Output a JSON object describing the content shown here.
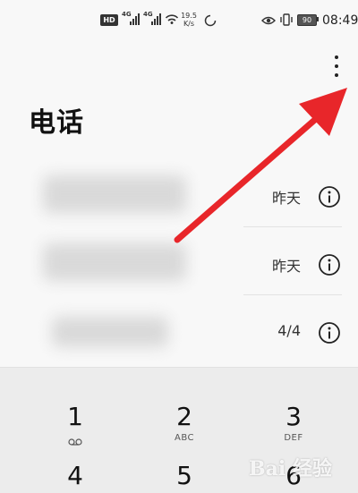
{
  "status_bar": {
    "hd_label": "HD",
    "signal_1_label": "4G",
    "signal_2_label": "4G",
    "network_speed_value": "19.5",
    "network_speed_unit": "K/s",
    "battery_level": "90",
    "time": "08:49"
  },
  "header": {
    "title": "电话"
  },
  "call_log": [
    {
      "name": "",
      "date": "昨天"
    },
    {
      "name": "",
      "date": "昨天"
    },
    {
      "name": "",
      "date": "4/4"
    }
  ],
  "dialpad": {
    "keys": [
      {
        "digit": "1",
        "letters": ""
      },
      {
        "digit": "2",
        "letters": "ABC"
      },
      {
        "digit": "3",
        "letters": "DEF"
      },
      {
        "digit": "4",
        "letters": ""
      },
      {
        "digit": "5",
        "letters": ""
      },
      {
        "digit": "6",
        "letters": ""
      }
    ]
  },
  "annotation": {
    "arrow_color": "#e8262a"
  },
  "watermark": {
    "text": "Bai 经验"
  },
  "colors": {
    "background": "#f8f8f8",
    "dialpad_background": "#ececec",
    "text_primary": "#111111",
    "arrow": "#e8262a"
  }
}
